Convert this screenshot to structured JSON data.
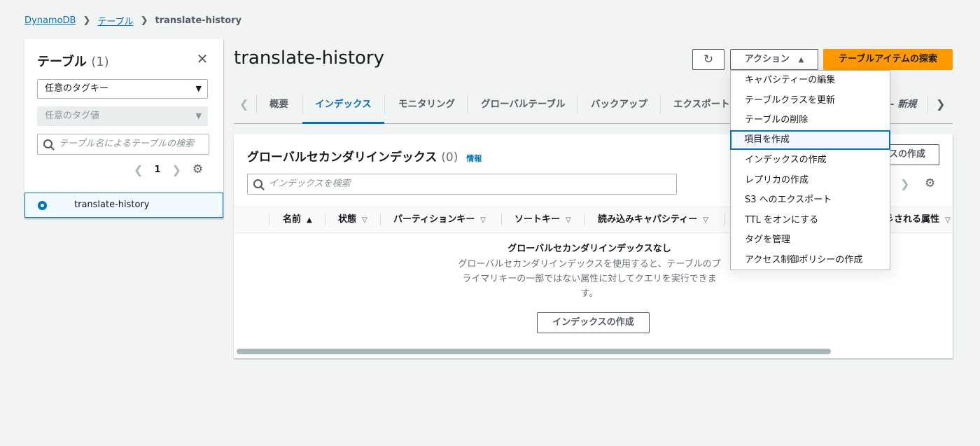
{
  "breadcrumb": {
    "item1": "DynamoDB",
    "item2": "テーブル",
    "current": "translate-history"
  },
  "sidebar": {
    "title": "テーブル",
    "count": "(1)",
    "tag_key_select": "任意のタグキー",
    "tag_value_select": "任意のタグ値",
    "search_placeholder": "テーブル名によるテーブルの検索",
    "page": "1",
    "tables": [
      {
        "name": "translate-history",
        "selected": true
      }
    ]
  },
  "header": {
    "title": "translate-history",
    "actions_label": "アクション",
    "explore_label": "テーブルアイテムの探索"
  },
  "tabs": {
    "overview": "概要",
    "indexes": "インデックス",
    "monitoring": "モニタリング",
    "global_tables": "グローバルテーブル",
    "backups": "バックアップ",
    "exports": "エクスポート",
    "new_suffix": "新規",
    "active": "インデックス"
  },
  "gsi": {
    "title": "グローバルセカンダリインデックス",
    "count": "(0)",
    "info": "情報",
    "create_button_partial": "スの作成",
    "search_placeholder": "インデックスを検索",
    "columns": {
      "name": "名前",
      "status": "状態",
      "partition_key": "パーティションキー",
      "sort_key": "ソートキー",
      "read_capacity": "読み込みキャパシティー",
      "projected": "彡される属性"
    },
    "empty_title": "グローバルセカンダリインデックスなし",
    "empty_desc": "グローバルセカンダリインデックスを使用すると、テーブルのプライマリキーの一部ではない属性に対してクエリを実行できます。",
    "create_button": "インデックスの作成"
  },
  "actions_menu": [
    "キャパシティーの編集",
    "テーブルクラスを更新",
    "テーブルの削除",
    "項目を作成",
    "インデックスの作成",
    "レプリカの作成",
    "S3 へのエクスポート",
    "TTL をオンにする",
    "タグを管理",
    "アクセス制御ポリシーの作成"
  ],
  "colors": {
    "link": "#0073bb",
    "primary": "#ff9900",
    "background": "#f2f3f3"
  }
}
